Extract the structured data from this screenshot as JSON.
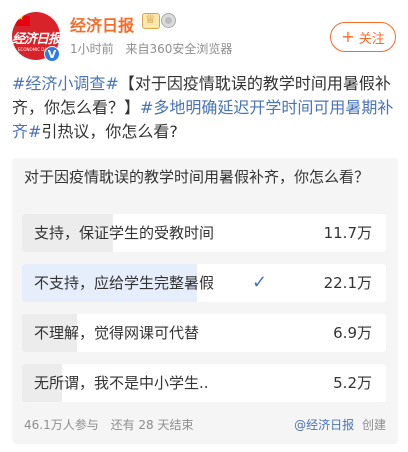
{
  "user": {
    "name": "经济日报",
    "avatar_text": "经济日报",
    "avatar_subtext": "ECONOMIC DAILY",
    "verified_mark": "V",
    "time": "1小时前",
    "source": "来自360安全浏览器",
    "follow_label": "关注",
    "follow_plus": "+"
  },
  "post": {
    "topic1": "#经济小调查#",
    "text1": "【对于因疫情耽误的教学时间用暑假补齐，你怎么看？】",
    "topic2": "#多地明确延迟开学时间可用暑期补齐#",
    "text2": "引热议，你怎么看?"
  },
  "poll": {
    "question": "对于因疫情耽误的教学时间用暑假补齐，你怎么看？",
    "options": [
      {
        "label": "支持，保证学生的受教时间",
        "count": "11.7万",
        "fraction": 0.25,
        "selected": false
      },
      {
        "label": "不支持，应给学生完整暑假",
        "count": "22.1万",
        "fraction": 0.48,
        "selected": true
      },
      {
        "label": "不理解，觉得网课可代替",
        "count": "6.9万",
        "fraction": 0.15,
        "selected": false
      },
      {
        "label": "无所谓，我不是中小学生..",
        "count": "5.2万",
        "fraction": 0.11,
        "selected": false
      }
    ],
    "participants": "46.1万人参与",
    "remaining": "还有 28 天结束",
    "creator": "@经济日报",
    "created_label": "创建"
  },
  "colors": {
    "accent": "#f86c2a",
    "link": "#4a74b8",
    "selected_fill": "#e6eefb"
  }
}
